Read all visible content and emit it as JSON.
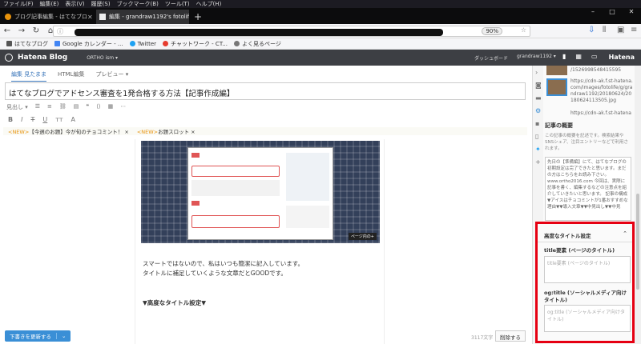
{
  "browser": {
    "menu": [
      "ファイル(F)",
      "編集(E)",
      "表示(V)",
      "履歴(S)",
      "ブックマーク(B)",
      "ツール(T)",
      "ヘルプ(H)"
    ],
    "tabs": [
      {
        "label": "ブログ記事編集 - はてなブロ"
      },
      {
        "label": "編集 - grandraw1192's fotolife"
      }
    ],
    "zoom": "90%",
    "bookmarks": [
      "はてなブログ",
      "Google カレンダー - ...",
      "Twitter",
      "チャットワーク - CT...",
      "よく見るページ"
    ]
  },
  "hatena": {
    "logo": "Hatena Blog",
    "blog_name": "ORTHO ism ▾",
    "dashboard": "ダッシュボード",
    "user": "grandraw1192 ▾",
    "brand": "Hatena"
  },
  "editor": {
    "tabs": [
      "編集 見たまま",
      "HTML編集",
      "プレビュー ▾"
    ],
    "title": "はてなブログでアドセンス審査を1発合格する方法【記事作成編】",
    "notice": {
      "new1": "<NEW>",
      "text1": "【今週のお題】今が旬のチョコミント！ ×",
      "new2": "<NEW>",
      "text2": "お題スロット ×"
    },
    "image_badge": "ページ内の+",
    "body_lines": [
      "スマートではないので、私はいつも簡潔に記入しています。",
      "タイトルに補足していくような文章だとGOODです。"
    ],
    "heading": "▼高度なタイトル設定▼",
    "save_button": "下書きを更新する",
    "char_count": "3117文字",
    "delete_button": "削除する"
  },
  "sidebar": {
    "photos": [
      {
        "url": "/1526998548415595"
      },
      {
        "url": "https://cdn-ak.f.st-hatena.com/images/fotolife/g/grandraw1192/20180624/20180624113505.jpg"
      },
      {
        "url": "https://cdn-ak.f.st-hatena"
      }
    ],
    "summary_heading": "記事の概要",
    "summary_desc": "この記事の概要を記述です。検索結果やSNSシェア、注目エントリーなどで利用されます。",
    "summary_text": "先日の【準備編】にて、はてなブログの初期設定は完了できたと思います。まだの方はこちらをお読み下さい。 www.ortho2016.com 今回は、実際に記事を書く、編集するなどの注意点を紹介していきたいと思います。 記事の構成 ▼アイスはチョコミントが1番おすすめな理由▼▼導入文章▼▼中見出し▼▼中見",
    "advanced_heading": "高度なタイトル設定",
    "title_label": "title要素 (ページのタイトル)",
    "title_placeholder": "title要素 (ページのタイトル)",
    "og_label": "og:title (ソーシャルメディア向けタイトル)",
    "og_placeholder": "og:title (ソーシャルメディア向けタイトル)"
  },
  "colors": {
    "highlight": "#e60012",
    "accent": "#3a8fd6",
    "header": "#3d3f44"
  }
}
